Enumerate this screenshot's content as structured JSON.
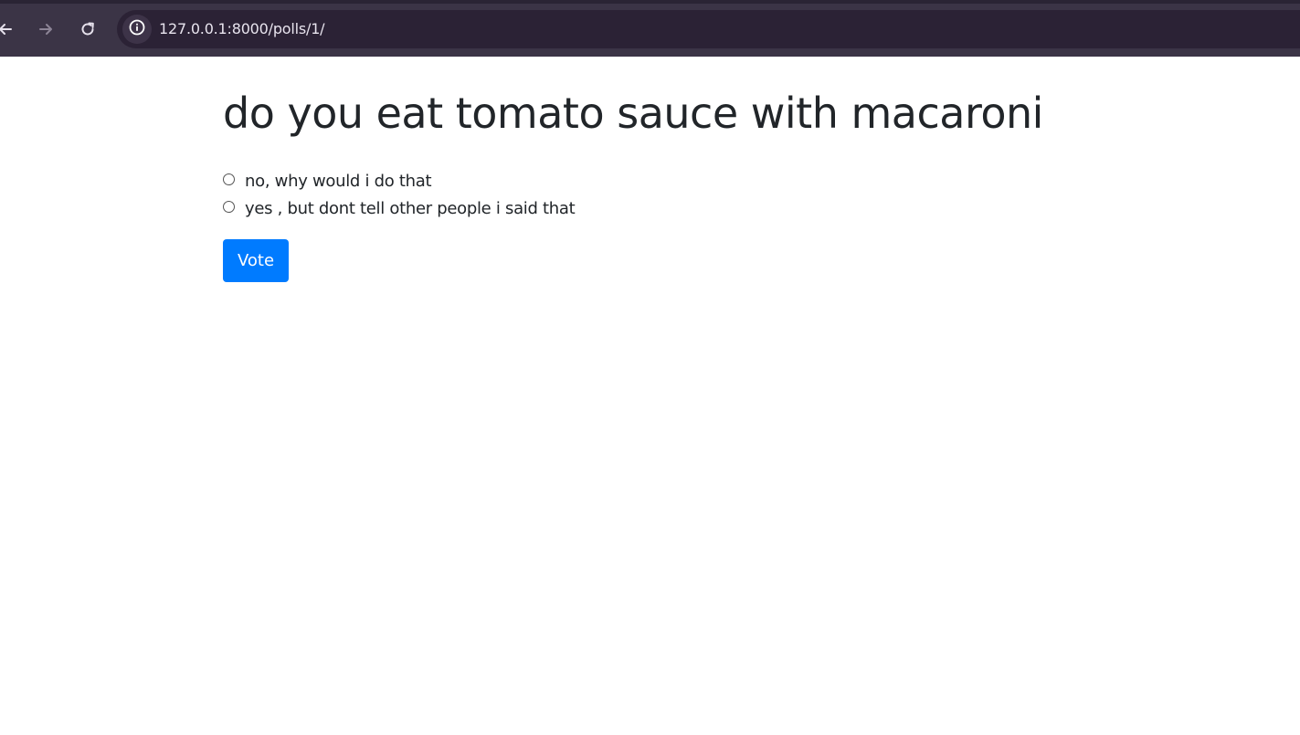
{
  "browser": {
    "url": "127.0.0.1:8000/polls/1/",
    "back_icon": "arrow-left-icon",
    "forward_icon": "arrow-right-icon",
    "reload_icon": "reload-icon",
    "site_info_icon": "info-circle-icon"
  },
  "poll": {
    "question": "do you eat tomato sauce with macaroni",
    "choices": [
      {
        "label": "no, why would i do that",
        "selected": false
      },
      {
        "label": "yes , but dont tell other people i said that",
        "selected": false
      }
    ],
    "vote_label": "Vote"
  },
  "colors": {
    "browser_frame": "#3b3446",
    "address_bar": "#2b2235",
    "primary_button": "#007bff",
    "text": "#212529"
  }
}
